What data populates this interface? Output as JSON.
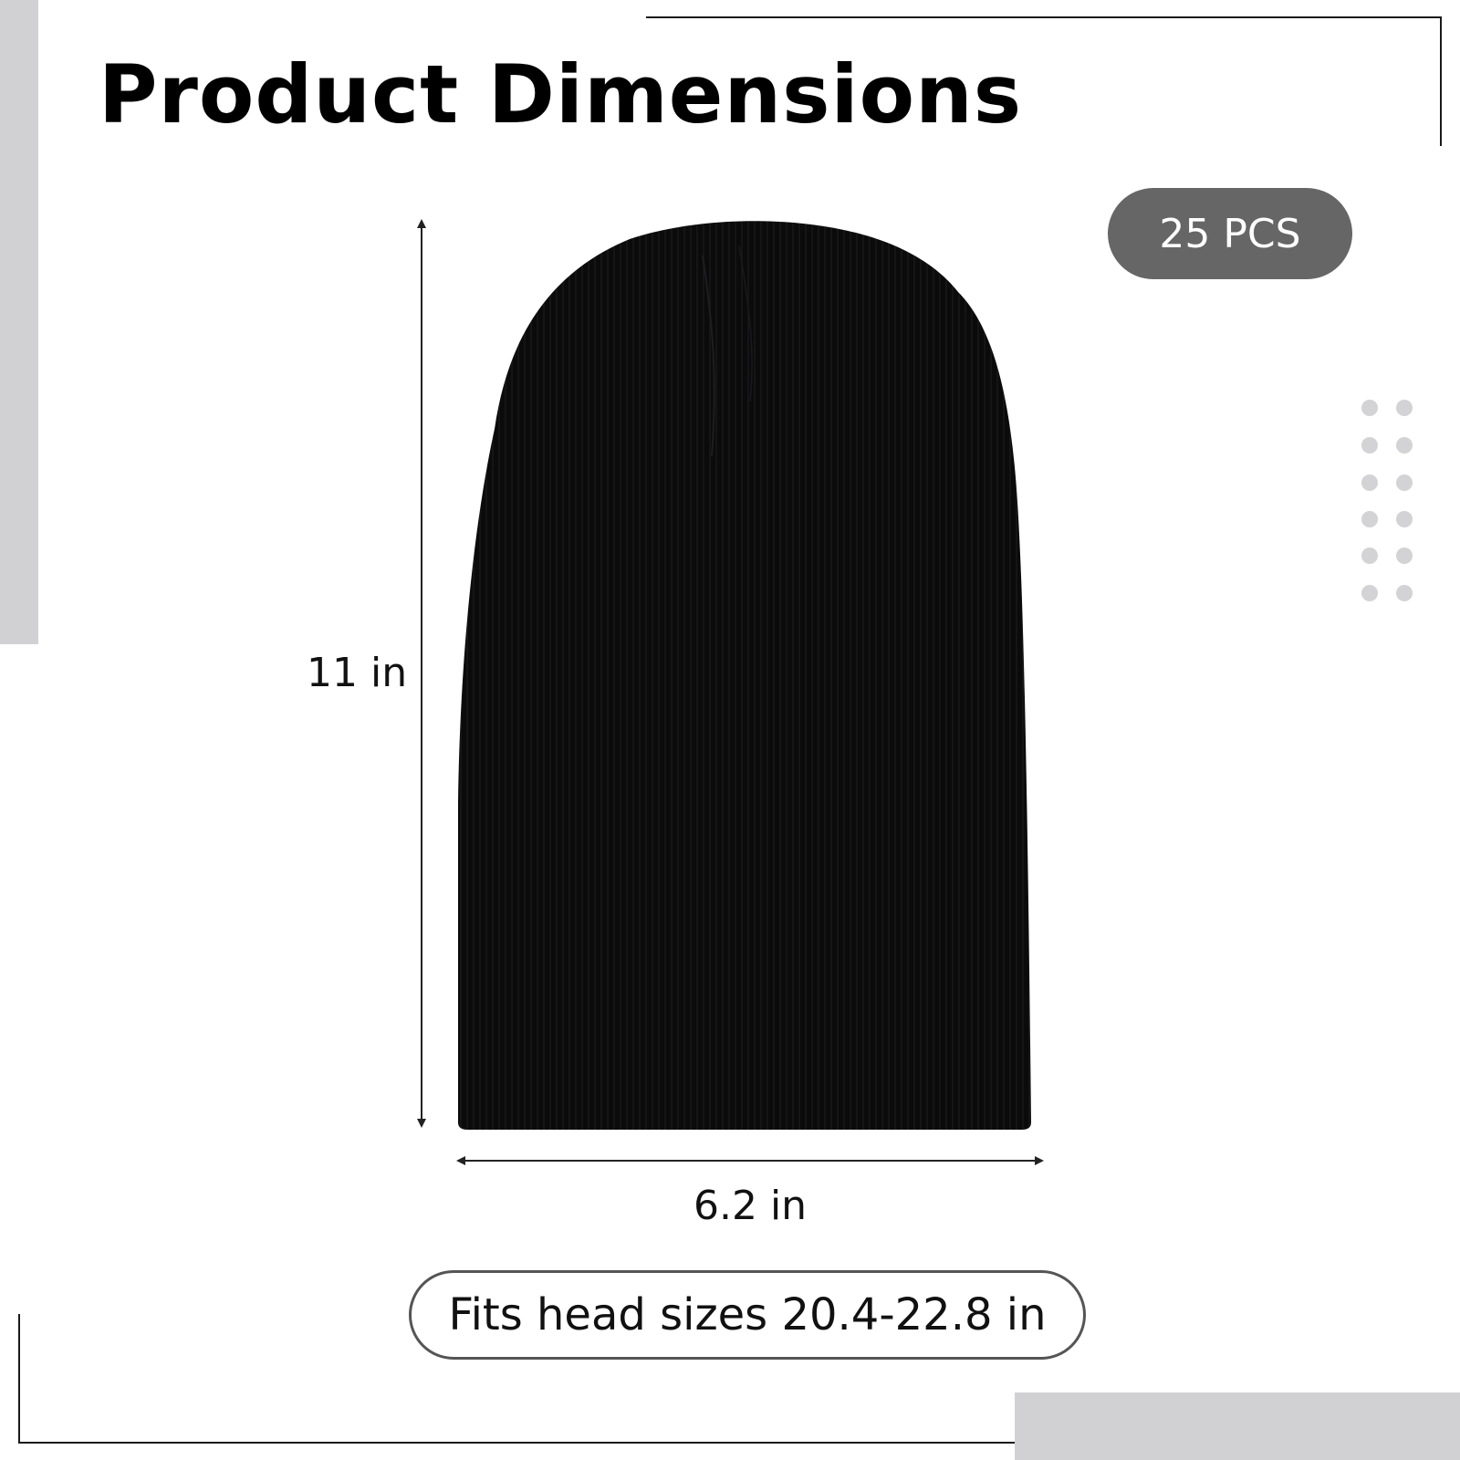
{
  "title": "Product Dimensions",
  "badge": {
    "quantity": "25 PCS"
  },
  "dimensions": {
    "height": "11 in",
    "width": "6.2 in"
  },
  "fit_note": "Fits head sizes 20.4-22.8 in",
  "product": {
    "image": "black-knit-beanie",
    "color": "#0b0b0c"
  },
  "colors": {
    "accent_gray": "#d1d1d3",
    "badge_gray": "#666666"
  }
}
